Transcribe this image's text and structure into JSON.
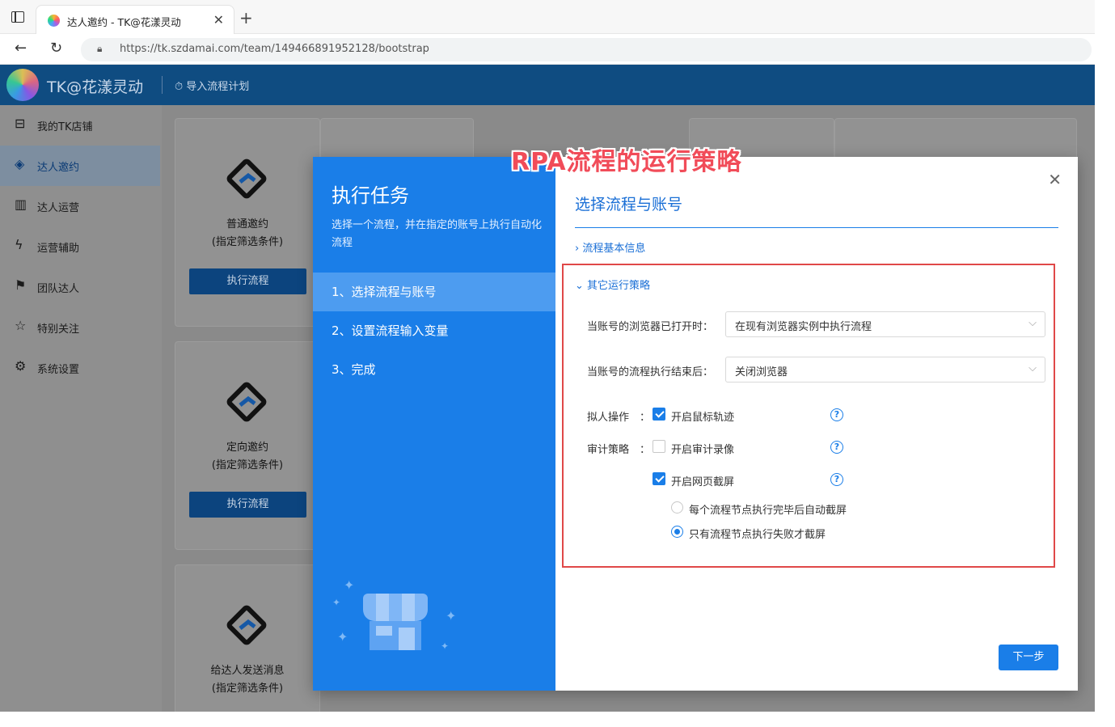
{
  "browser": {
    "tab_title": "达人邀约 - TK@花漾灵动",
    "url": "https://tk.szdamai.com/team/1494668919521​28/bootstrap",
    "new_tab": "+",
    "close_tab": "✕"
  },
  "app": {
    "brand": "TK@花漾灵动",
    "import_plan": "导入流程计划"
  },
  "sidebar": {
    "items": [
      {
        "label": "我的TK店铺",
        "icon": "store-icon",
        "glyph": "⊟"
      },
      {
        "label": "达人邀约",
        "icon": "handshake-icon",
        "glyph": "◈"
      },
      {
        "label": "达人运营",
        "icon": "bar-chart-icon",
        "glyph": "▥"
      },
      {
        "label": "运营辅助",
        "icon": "lightning-icon",
        "glyph": "ϟ"
      },
      {
        "label": "团队达人",
        "icon": "team-icon",
        "glyph": "⚑"
      },
      {
        "label": "特别关注",
        "icon": "star-icon",
        "glyph": "☆"
      },
      {
        "label": "系统设置",
        "icon": "gear-icon",
        "glyph": "⚙"
      }
    ],
    "active_index": 1
  },
  "cards": [
    {
      "title": "普通邀约",
      "subtitle": "(指定筛选条件)",
      "button": "执行流程"
    },
    {
      "title": "定向邀约",
      "subtitle": "(指定筛选条件)",
      "button": "执行流程"
    },
    {
      "title": "给达人发送消息",
      "subtitle": "(指定筛选条件)"
    }
  ],
  "modal": {
    "left_title": "执行任务",
    "left_desc": "选择一个流程，并在指定的账号上执行自动化流程",
    "steps": [
      "1、选择流程与账号",
      "2、设置流程输入变量",
      "3、完成"
    ],
    "active_step": 0,
    "title": "选择流程与账号",
    "close": "✕",
    "section_basic": "流程基本信息",
    "section_other": "其它运行策略",
    "browser_open_label": "当账号的浏览器已打开时：",
    "browser_open_value": "在现有浏览器实例中执行流程",
    "after_finish_label": "当账号的流程执行结束后：",
    "after_finish_value": "关闭浏览器",
    "humanlike_label": "拟人操作",
    "humanlike_colon": "：",
    "mouse_track": "开启鼠标轨迹",
    "mouse_track_checked": true,
    "audit_label": "审计策略",
    "audit_colon": "：",
    "audit_record": "开启审计录像",
    "audit_record_checked": false,
    "screenshot": "开启网页截屏",
    "screenshot_checked": true,
    "radio_every_node": "每个流程节点执行完毕后自动截屏",
    "radio_fail_only": "只有流程节点执行失败才截屏",
    "radio_selected": "fail_only",
    "help": "?",
    "next_button": "下一步"
  },
  "annotation": "RPA流程的运行策略",
  "colors": {
    "primary": "#1a7ee8",
    "header": "#0f4c81",
    "annotation": "#f14c59",
    "highlight_box": "#e04848"
  }
}
